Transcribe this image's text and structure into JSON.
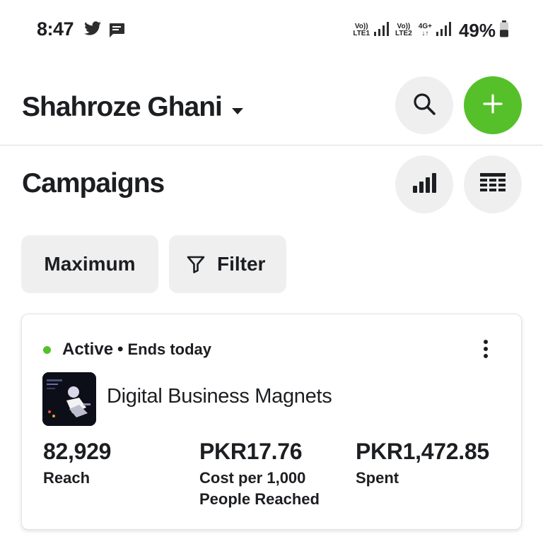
{
  "status_bar": {
    "time": "8:47",
    "icons": [
      "twitter-bird-icon",
      "message-bubble-icon"
    ],
    "sim1_top": "Vo))",
    "sim1_bottom": "LTE1",
    "sim2_top": "Vo))",
    "sim2_bottom": "LTE2",
    "data_top": "4G+",
    "data_bottom": "↓↑",
    "battery_percent": "49%",
    "battery_level": 0.49
  },
  "header": {
    "account_name": "Shahroze Ghani",
    "actions": [
      "search-icon",
      "plus-icon"
    ]
  },
  "section": {
    "title": "Campaigns",
    "actions": [
      "bar-chart-icon",
      "table-icon"
    ]
  },
  "filters": {
    "date_label": "Maximum",
    "filter_label": "Filter"
  },
  "campaign": {
    "status": "Active",
    "separator": "•",
    "ends": "Ends today",
    "status_color": "#56c02b",
    "name": "Digital Business Magnets",
    "metrics": [
      {
        "value": "82,929",
        "label": "Reach"
      },
      {
        "value": "PKR17.76",
        "label": "Cost per 1,000 People Reached"
      },
      {
        "value": "PKR1,472.85",
        "label": "Spent"
      }
    ]
  },
  "colors": {
    "accent": "#56c02b",
    "button_bg": "#efefef",
    "text": "#1c1e21"
  }
}
